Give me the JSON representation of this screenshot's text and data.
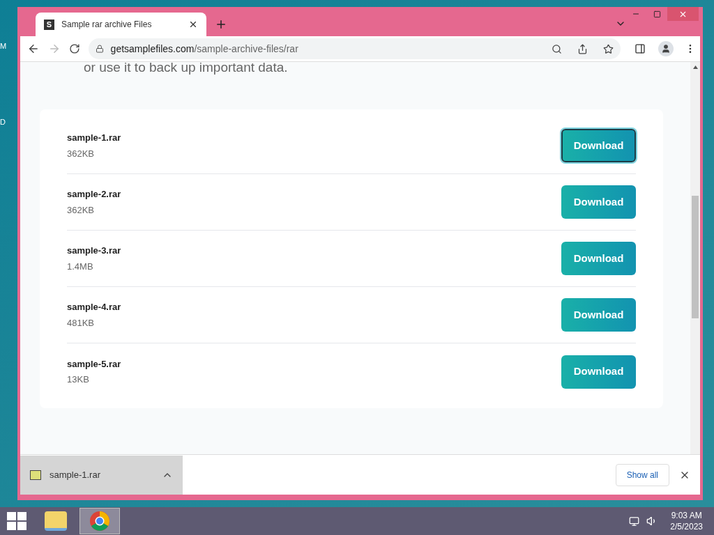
{
  "desktop_labels": [
    "M",
    "D"
  ],
  "browser": {
    "tab_title": "Sample rar archive Files",
    "favicon": "S",
    "url_domain": "getsamplefiles.com",
    "url_path": "/sample-archive-files/rar"
  },
  "page": {
    "intro_text": "or use it to back up important data.",
    "files": [
      {
        "name": "sample-1.rar",
        "size": "362KB",
        "button": "Download",
        "focused": true
      },
      {
        "name": "sample-2.rar",
        "size": "362KB",
        "button": "Download",
        "focused": false
      },
      {
        "name": "sample-3.rar",
        "size": "1.4MB",
        "button": "Download",
        "focused": false
      },
      {
        "name": "sample-4.rar",
        "size": "481KB",
        "button": "Download",
        "focused": false
      },
      {
        "name": "sample-5.rar",
        "size": "13KB",
        "button": "Download",
        "focused": false
      }
    ]
  },
  "download_bar": {
    "item": "sample-1.rar",
    "show_all": "Show all"
  },
  "taskbar": {
    "time": "9:03 AM",
    "date": "2/5/2023"
  }
}
